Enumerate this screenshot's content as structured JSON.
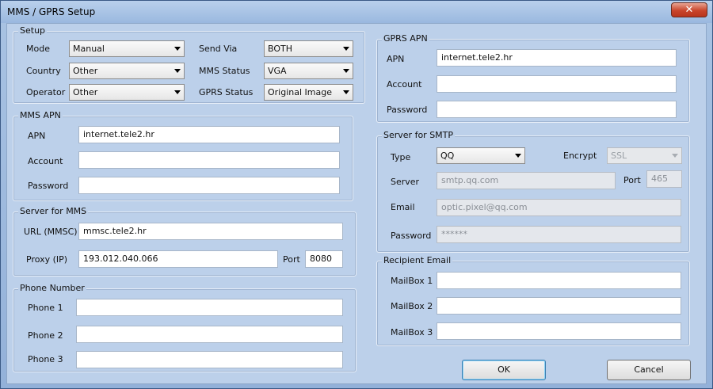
{
  "window": {
    "title": "MMS / GPRS Setup",
    "close": "✕"
  },
  "setup": {
    "label": "Setup",
    "mode": {
      "label": "Mode",
      "value": "Manual"
    },
    "country": {
      "label": "Country",
      "value": "Other"
    },
    "operator": {
      "label": "Operator",
      "value": "Other"
    },
    "send_via": {
      "label": "Send Via",
      "value": "BOTH"
    },
    "mms_status": {
      "label": "MMS Status",
      "value": "VGA"
    },
    "gprs_status": {
      "label": "GPRS Status",
      "value": "Original Image"
    }
  },
  "mms_apn": {
    "label": "MMS APN",
    "apn": {
      "label": "APN",
      "value": "internet.tele2.hr"
    },
    "account": {
      "label": "Account",
      "value": ""
    },
    "password": {
      "label": "Password",
      "value": ""
    }
  },
  "server_mms": {
    "label": "Server for MMS",
    "url": {
      "label": "URL (MMSC)",
      "value": "mmsc.tele2.hr"
    },
    "proxy": {
      "label": "Proxy (IP)",
      "value": "193.012.040.066"
    },
    "port": {
      "label": "Port",
      "value": "8080"
    }
  },
  "phone": {
    "label": "Phone Number",
    "phone1": {
      "label": "Phone 1",
      "value": ""
    },
    "phone2": {
      "label": "Phone 2",
      "value": ""
    },
    "phone3": {
      "label": "Phone 3",
      "value": ""
    }
  },
  "gprs_apn": {
    "label": "GPRS APN",
    "apn": {
      "label": "APN",
      "value": "internet.tele2.hr"
    },
    "account": {
      "label": "Account",
      "value": ""
    },
    "password": {
      "label": "Password",
      "value": ""
    }
  },
  "smtp": {
    "label": "Server for SMTP",
    "type": {
      "label": "Type",
      "value": "QQ"
    },
    "encrypt": {
      "label": "Encrypt",
      "value": "SSL"
    },
    "server": {
      "label": "Server",
      "value": "smtp.qq.com"
    },
    "port": {
      "label": "Port",
      "value": "465"
    },
    "email": {
      "label": "Email",
      "value": "optic.pixel@qq.com"
    },
    "password": {
      "label": "Password",
      "value": "******"
    }
  },
  "recipient": {
    "label": "Recipient Email",
    "mailbox1": {
      "label": "MailBox 1",
      "value": ""
    },
    "mailbox2": {
      "label": "MailBox 2",
      "value": ""
    },
    "mailbox3": {
      "label": "MailBox 3",
      "value": ""
    }
  },
  "buttons": {
    "ok": "OK",
    "cancel": "Cancel"
  }
}
